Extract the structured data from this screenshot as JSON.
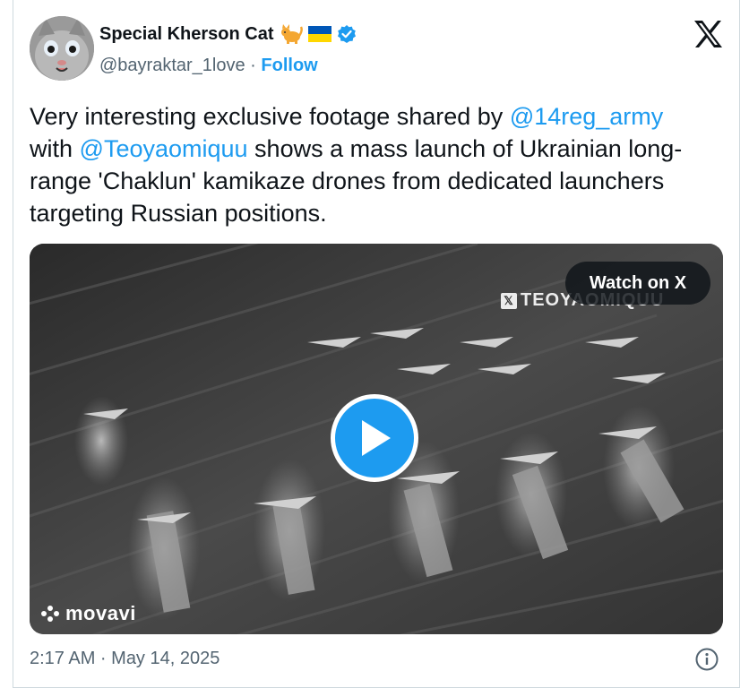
{
  "author": {
    "display_name": "Special Kherson Cat",
    "handle": "@bayraktar_1love",
    "separator": "·",
    "follow_label": "Follow",
    "cat_emoji": "cat-emoji",
    "flag": "ukraine-flag",
    "verified": "verified-badge"
  },
  "tweet": {
    "text_parts": [
      {
        "type": "text",
        "value": "Very interesting exclusive footage shared by "
      },
      {
        "type": "mention",
        "value": "@14reg_army"
      },
      {
        "type": "text",
        "value": " with "
      },
      {
        "type": "mention",
        "value": "@Teoyaomiquu"
      },
      {
        "type": "text",
        "value": " shows a mass launch of Ukrainian long-range 'Chaklun' kamikaze drones from dedicated launchers targeting Russian positions."
      }
    ]
  },
  "media": {
    "watch_label": "Watch on X",
    "watermark_top": "TEOYAOMIQUU",
    "watermark_bottom": "movavi"
  },
  "footer": {
    "timestamp": "2:17 AM · May 14, 2025"
  },
  "colors": {
    "accent": "#1d9bf0",
    "secondary_text": "#536471",
    "primary_text": "#0f1419"
  }
}
